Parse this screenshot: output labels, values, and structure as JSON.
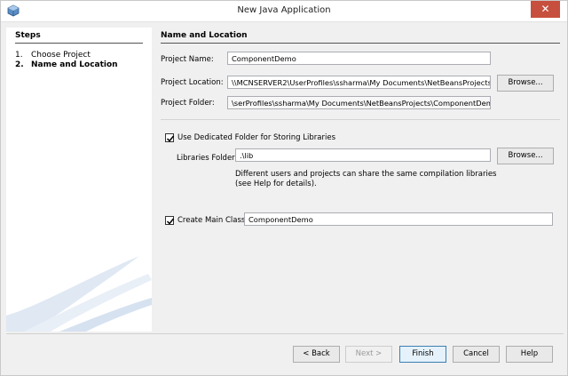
{
  "window": {
    "title": "New Java Application",
    "close_glyph": "✕"
  },
  "steps": {
    "header": "Steps",
    "items": [
      {
        "number": "1.",
        "label": "Choose Project"
      },
      {
        "number": "2.",
        "label": "Name and Location"
      }
    ]
  },
  "panel": {
    "header": "Name and Location",
    "project_name_label": "Project Name:",
    "project_name_value": "ComponentDemo",
    "project_location_label": "Project Location:",
    "project_location_value": "\\\\MCNSERVER2\\UserProfiles\\ssharma\\My Documents\\NetBeansProjects",
    "project_folder_label": "Project Folder:",
    "project_folder_value": "\\serProfiles\\ssharma\\My Documents\\NetBeansProjects\\ComponentDemo",
    "browse_label": "Browse...",
    "dedicated_folder_label": "Use Dedicated Folder for Storing Libraries",
    "libraries_folder_label": "Libraries Folder:",
    "libraries_folder_value": ".\\lib",
    "libraries_note_line1": "Different users and projects can share the same compilation libraries",
    "libraries_note_line2": "(see Help for details).",
    "create_main_class_label": "Create Main Class",
    "main_class_value": "ComponentDemo"
  },
  "buttons": {
    "back": "< Back",
    "next": "Next >",
    "finish": "Finish",
    "cancel": "Cancel",
    "help": "Help"
  }
}
